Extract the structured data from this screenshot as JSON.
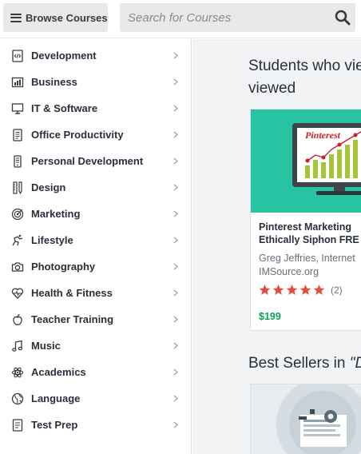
{
  "header": {
    "browse_label": "Browse Courses",
    "search_placeholder": "Search for Courses",
    "browse_icon": "hamburger-menu-icon",
    "search_icon": "search-icon"
  },
  "sidebar": {
    "items": [
      {
        "label": "Development",
        "icon": "code-file-icon"
      },
      {
        "label": "Business",
        "icon": "bar-chart-icon"
      },
      {
        "label": "IT & Software",
        "icon": "monitor-icon"
      },
      {
        "label": "Office Productivity",
        "icon": "document-list-icon"
      },
      {
        "label": "Personal Development",
        "icon": "mobile-icon"
      },
      {
        "label": "Design",
        "icon": "pencil-ruler-icon"
      },
      {
        "label": "Marketing",
        "icon": "target-icon"
      },
      {
        "label": "Lifestyle",
        "icon": "cycling-icon"
      },
      {
        "label": "Photography",
        "icon": "camera-icon"
      },
      {
        "label": "Health & Fitness",
        "icon": "heartbeat-icon"
      },
      {
        "label": "Teacher Training",
        "icon": "apple-icon"
      },
      {
        "label": "Music",
        "icon": "music-note-icon"
      },
      {
        "label": "Academics",
        "icon": "atom-icon"
      },
      {
        "label": "Language",
        "icon": "globe-icon"
      },
      {
        "label": "Test Prep",
        "icon": "checklist-icon"
      }
    ]
  },
  "main": {
    "section1_title_line1": "Students who vie",
    "section1_title_line2": "viewed",
    "course": {
      "title_line1": "Pinterest Marketing",
      "title_line2": "Ethically Siphon FRE",
      "author_line1": "Greg Jeffries, Internet",
      "author_line2": "IMSource.org",
      "rating": 5,
      "rating_count": "(2)",
      "price": "$199",
      "thumb_brand": "Pinterest"
    },
    "section2_title_prefix": "Best Sellers in ",
    "section2_title_quoted": "\"D"
  },
  "colors": {
    "accent_teal": "#27c3a3",
    "price_green": "#0f9d58",
    "star_orange": "#f4c150",
    "star_red": "#e24c3f"
  }
}
